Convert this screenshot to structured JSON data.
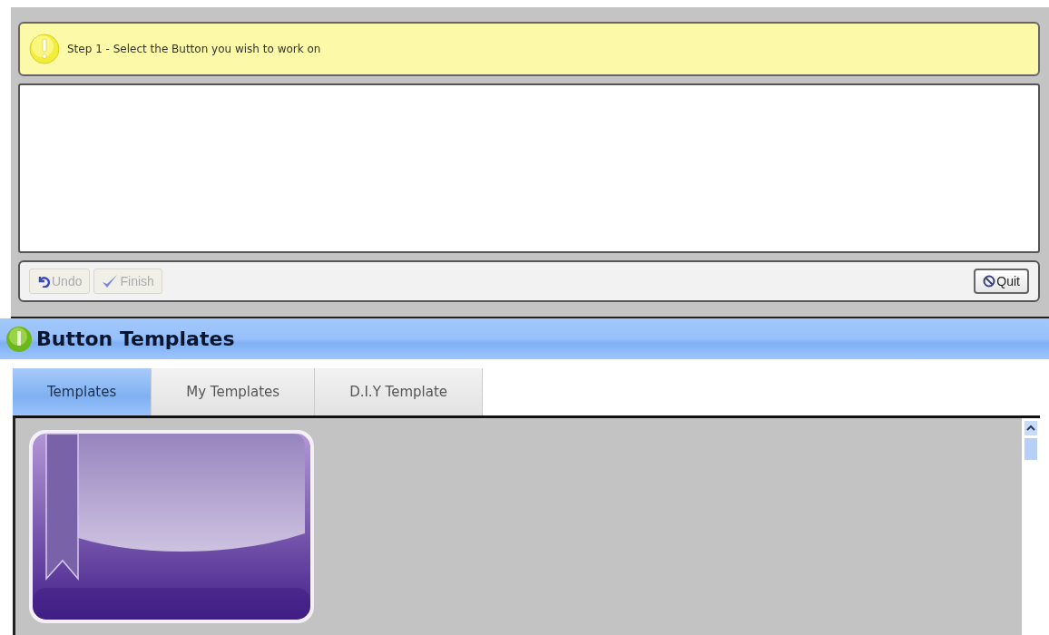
{
  "wizard": {
    "step_message": "Step 1 - Select the Button you wish to work on",
    "toolbar": [
      {
        "label": "Undo",
        "kind": "undo",
        "disabled": true
      },
      {
        "label": "Finish",
        "kind": "finish",
        "disabled": true
      }
    ],
    "quit_button": {
      "label": "Quit",
      "disabled": false
    }
  },
  "panel": {
    "title": "Button Templates",
    "tabs": [
      {
        "label": "Templates",
        "selected": true
      },
      {
        "label": "My Templates",
        "selected": false
      },
      {
        "label": "D.I.Y Template",
        "selected": false
      }
    ]
  }
}
